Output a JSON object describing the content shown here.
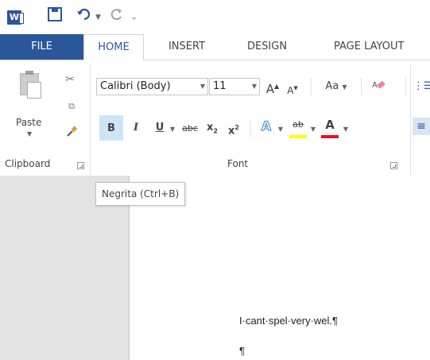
{
  "app": {
    "logo_letter": "W"
  },
  "quick_access": {
    "save_icon": "save-icon",
    "undo_icon": "undo-icon",
    "redo_icon": "redo-icon",
    "customize_icon": "customize-qat-icon"
  },
  "tabs": [
    {
      "label": "FILE"
    },
    {
      "label": "HOME"
    },
    {
      "label": "INSERT"
    },
    {
      "label": "DESIGN"
    },
    {
      "label": "PAGE LAYOUT"
    }
  ],
  "clipboard": {
    "paste_label": "Paste",
    "group_label": "Clipboard"
  },
  "font": {
    "family": "Calibri (Body)",
    "size": "11",
    "grow_label": "A",
    "shrink_label": "A",
    "change_case_label": "Aa",
    "bold_label": "B",
    "italic_label": "I",
    "underline_label": "U",
    "strike_label": "abc",
    "subscript_label": "x",
    "superscript_label": "x",
    "text_effects_label": "A",
    "highlight_label": "ab",
    "font_color_label": "A",
    "group_label": "Font"
  },
  "colors": {
    "accent": "#2b579a",
    "highlight": "#ffff00",
    "font_color": "#e81123"
  },
  "tooltip": {
    "text": "Negrita (Ctrl+B)"
  },
  "document": {
    "line1": "I·cant·spel·very·wel.¶",
    "line2": "¶"
  }
}
